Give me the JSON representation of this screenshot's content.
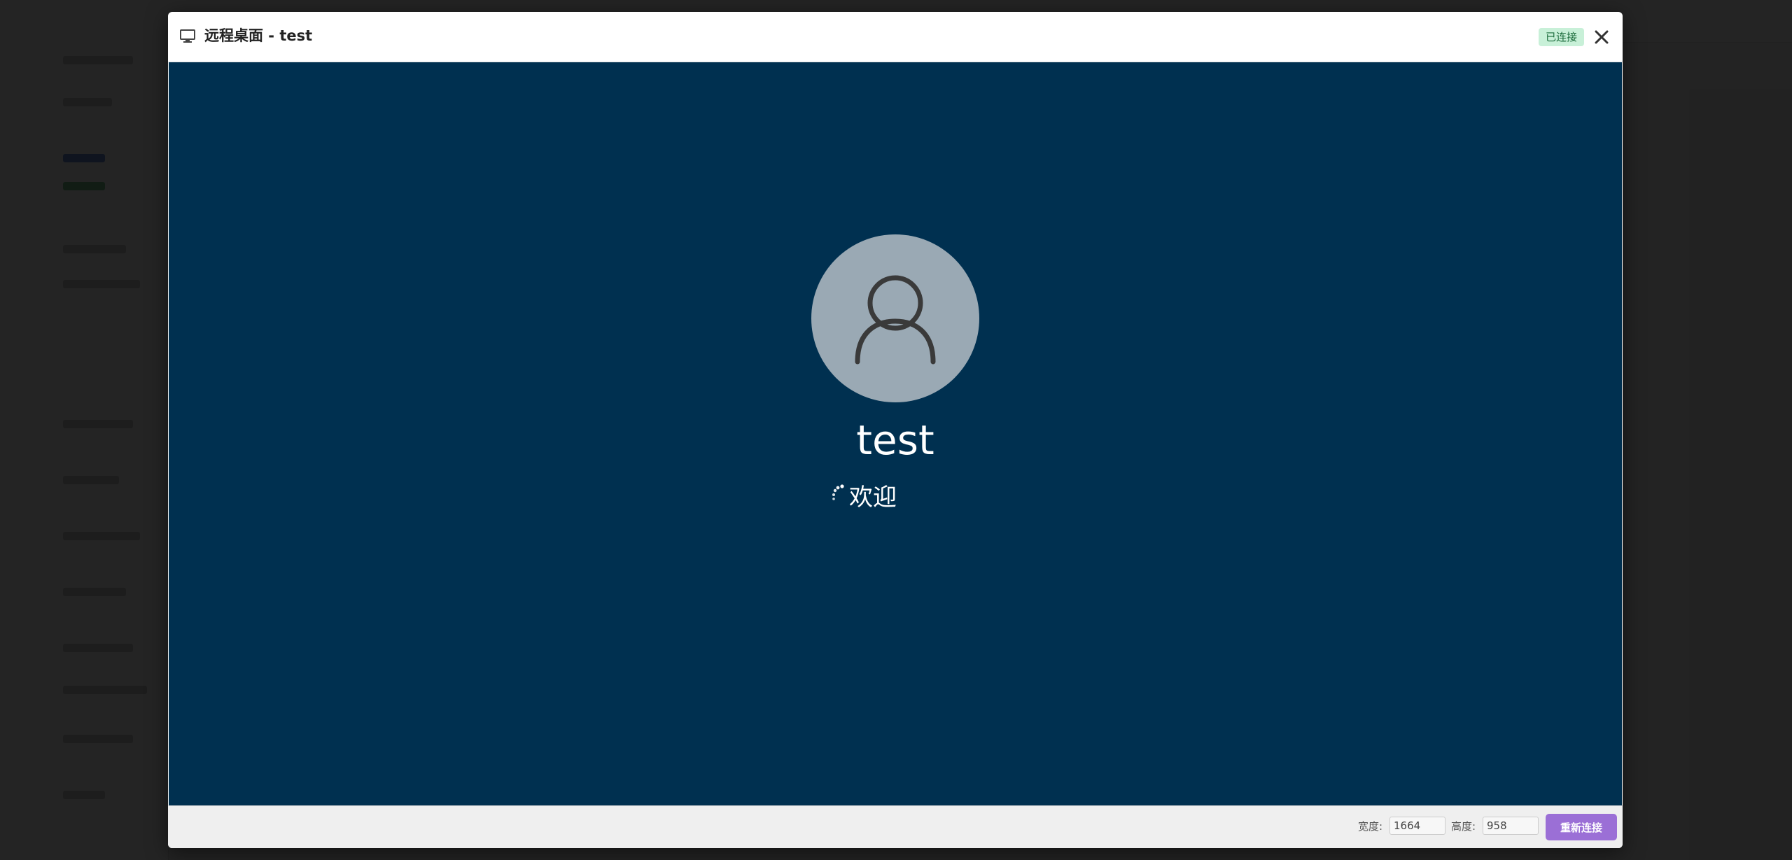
{
  "modal": {
    "title": "远程桌面 - test",
    "status": "已连接",
    "close_label": "✕"
  },
  "remote": {
    "user_name": "test",
    "welcome": "欢迎"
  },
  "footer": {
    "width_label": "宽度:",
    "width_value": "1664",
    "height_label": "高度:",
    "height_value": "958",
    "reconnect_label": "重新连接"
  },
  "colors": {
    "remote_background": "#003050",
    "avatar": "#9aa9b4",
    "status_badge_bg": "#c8f0d8",
    "reconnect_button": "#9b6fd6"
  },
  "icons": {
    "title_icon": "monitor-icon",
    "close_icon": "close-icon",
    "avatar_icon": "user-icon",
    "loading_icon": "spinner-icon"
  }
}
